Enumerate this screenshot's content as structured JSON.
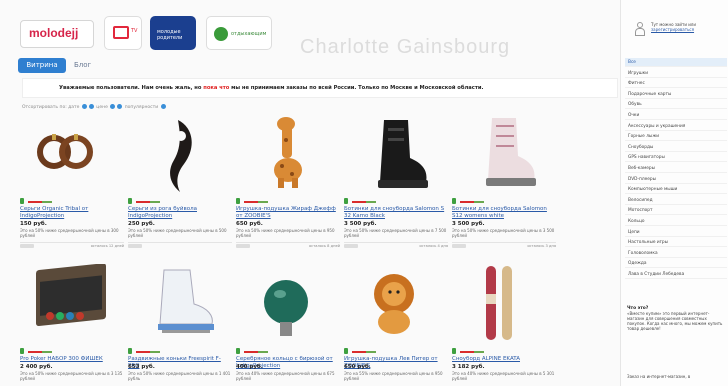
{
  "header": {
    "logo": "molodejj",
    "tv_label": "TV",
    "mp_label": "молодые родители",
    "green_label": "отдыхающим",
    "ghost": "Charlotte Gainsbourg"
  },
  "nav": {
    "active": "Витрина",
    "blog": "Блог"
  },
  "notice": {
    "part1": "Уважаемые пользователи. Нам очень жаль, но ",
    "highlight": "пока что",
    "part2": " мы не принимаем заказы по всей России. Только по Москве и Московской области."
  },
  "sort": {
    "label": "Отсортировать по: дате",
    "price": "цене",
    "popularity": "популярности"
  },
  "products": [
    {
      "title": "Серьги Organic Tribal от IndigoProjection",
      "price": "150 руб.",
      "desc": "Это на 50% ниже среднерыночной цены в 300 рублей",
      "left": "осталось 12 дней"
    },
    {
      "title": "Серьги из рога буйвола IndigoProjection",
      "price": "250 руб.",
      "desc": "Это на 50% ниже среднерыночной цены в 500 рублей",
      "left": ""
    },
    {
      "title": "Игрушка-подушка Жираф Джефф от ZOOBIE'S",
      "price": "650 руб.",
      "desc": "Это на 50% ниже среднерыночной цены в 950 рублей",
      "left": "осталось 8 дней"
    },
    {
      "title": "Ботинки для сноуборда Salomon S 32 Kamo Black",
      "price": "3 500 руб.",
      "desc": "Это на 50% ниже среднерыночной цены в 7 500 рублей",
      "left": "осталось 4 дня"
    },
    {
      "title": "Ботинки для сноуборда Salomon S12 womens white",
      "price": "3 500 руб.",
      "desc": "Это на 50% ниже среднерыночной цены в 3 500 рублей",
      "left": "осталось 3 дня"
    },
    {
      "title": "Pro Poker НАБОР 300 ФИШЕК",
      "price": "2 400 руб.",
      "desc": "Это на 50% ниже среднерыночной цены в 3 135 рублей",
      "left": ""
    },
    {
      "title": "Раздвижные коньки Freespirit F-PRO",
      "price": "653 руб.",
      "desc": "Это на 50% ниже среднерыночной цены в 1 401 рубль",
      "left": ""
    },
    {
      "title": "Серебряное кольцо с бирюзой от IndigoProjection",
      "price": "400 руб.",
      "desc": "Это на 40% ниже среднерыночной цены в 675 рублей",
      "left": ""
    },
    {
      "title": "Игрушка-подушка Лев Питер от ZOOBIE'S",
      "price": "650 руб.",
      "desc": "Это на 55% ниже среднерыночной цены в 950 рублей",
      "left": ""
    },
    {
      "title": "Сноуборд ALPINE EKATA",
      "price": "3 182 руб.",
      "desc": "Это на 40% ниже среднерыночной цены в 5 301 рублей",
      "left": "осталось 23 дня"
    }
  ],
  "sidebar": {
    "greeting": "Тут можно зайти или",
    "register": "зарегистрироваться",
    "categories": [
      "Все",
      "Игрушки",
      "Фитнес",
      "Подарочные карты",
      "Обувь",
      "Очки",
      "Аксессуары и украшения",
      "Горные лыжи",
      "Сноуборды",
      "GPS навигаторы",
      "Веб-камеры",
      "DVD-плееры",
      "Компьютерные мыши",
      "Велосипед",
      "Мотоспорт",
      "Кольцо",
      "Цепи",
      "Настольные игры",
      "Головоломка",
      "Одежда",
      "Лава в Студии Лебедева"
    ],
    "what_title": "Что это?",
    "what_text": "«Вместе купим» это первый интернет-магазин для совершения совместных покупок. Когда нас много, мы можем купить товар дешевле!",
    "shop_text": "Заказ на интернет-магазин, в"
  },
  "colors": {
    "accent": "#2f7fd0",
    "link": "#2a5aa8",
    "alert": "#e02020"
  }
}
